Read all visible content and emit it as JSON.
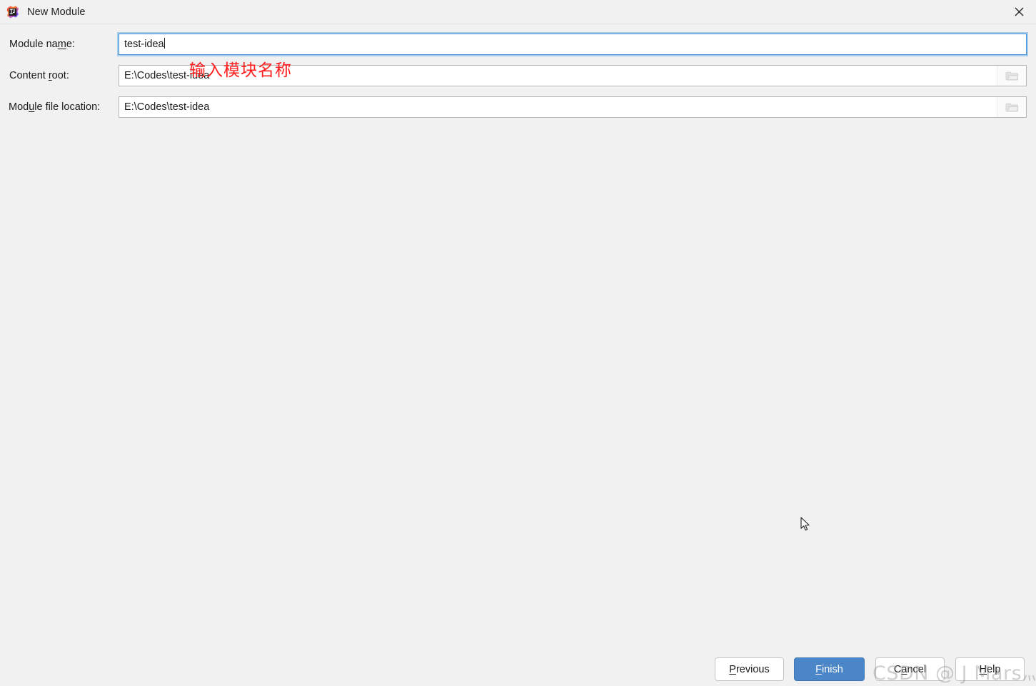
{
  "window": {
    "title": "New Module",
    "icon": "intellij-idea-icon",
    "close_icon": "close-icon",
    "background_color": "#f1f1f1"
  },
  "form": {
    "fields": [
      {
        "label_prefix": "Module na",
        "label_mnemonic": "m",
        "label_suffix": "e:",
        "value": "test-idea",
        "focused": true,
        "has_browse": false,
        "name": "module-name"
      },
      {
        "label_prefix": "Content ",
        "label_mnemonic": "r",
        "label_suffix": "oot:",
        "value": "E:\\Codes\\test-idea",
        "focused": false,
        "has_browse": true,
        "name": "content-root"
      },
      {
        "label_prefix": "Mod",
        "label_mnemonic": "u",
        "label_suffix": "le file location:",
        "value": "E:\\Codes\\test-idea",
        "focused": false,
        "has_browse": true,
        "name": "module-file-location"
      }
    ],
    "browse_icon": "folder-icon"
  },
  "annotation": {
    "text": "输入模块名称",
    "color": "#fd1d1d"
  },
  "buttons": {
    "previous": {
      "prefix": "",
      "mnemonic": "P",
      "suffix": "revious"
    },
    "finish": {
      "prefix": "",
      "mnemonic": "F",
      "suffix": "inish",
      "accent_color": "#4a86c8"
    },
    "cancel": {
      "prefix": "C",
      "mnemonic": "a",
      "suffix": "ncel"
    },
    "help": {
      "prefix": "",
      "mnemonic": "H",
      "suffix": "elp"
    }
  },
  "watermark": {
    "text": "CSDN @ J Mars灬龙族-"
  }
}
